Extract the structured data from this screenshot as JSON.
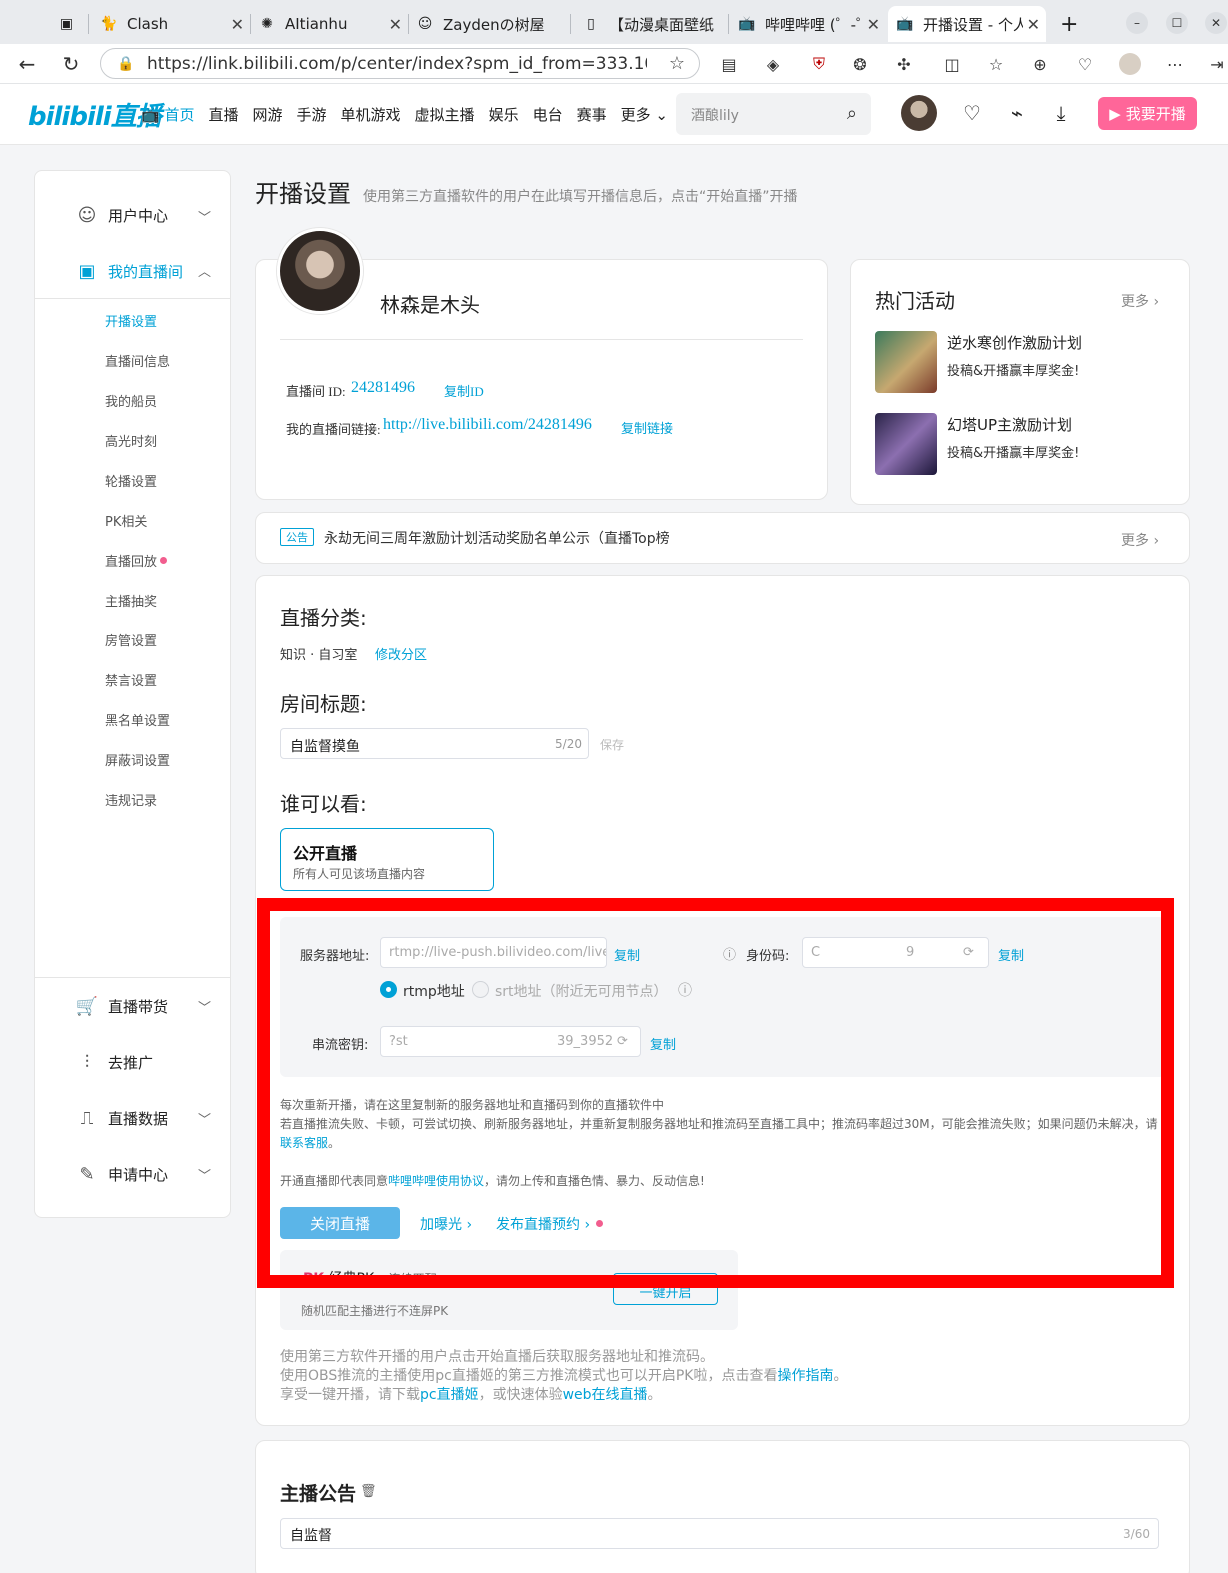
{
  "browser": {
    "tabs": [
      {
        "title": "Clash",
        "icon": "cat-icon"
      },
      {
        "title": "AItianhu",
        "icon": "openai-icon"
      },
      {
        "title": "Zaydenの树屋",
        "icon": "emoji-icon"
      },
      {
        "title": "【动漫桌面壁纸",
        "icon": "page-icon"
      },
      {
        "title": "哔哩哔哩 (゜-゜",
        "icon": "bilibili-icon"
      },
      {
        "title": "开播设置 - 个人",
        "icon": "bilibili-icon"
      }
    ],
    "url": "https://link.bilibili.com/p/center/index?spm_id_from=333.100..."
  },
  "header": {
    "logo": "bilibili直播",
    "nav": [
      "首页",
      "直播",
      "网游",
      "手游",
      "单机游戏",
      "虚拟主播",
      "娱乐",
      "电台",
      "赛事",
      "更多"
    ],
    "search_placeholder": "酒酿lily",
    "go_live_label": "我要开播"
  },
  "sidebar": {
    "groups": [
      {
        "label": "用户中心",
        "icon": "user-center-icon"
      },
      {
        "label": "我的直播间",
        "icon": "live-room-icon"
      }
    ],
    "items": [
      "开播设置",
      "直播间信息",
      "我的船员",
      "高光时刻",
      "轮播设置",
      "PK相关",
      "直播回放",
      "主播抽奖",
      "房管设置",
      "禁言设置",
      "黑名单设置",
      "屏蔽词设置",
      "违规记录"
    ],
    "bottom_groups": [
      {
        "label": "直播带货",
        "icon": "cart-icon"
      },
      {
        "label": "去推广",
        "icon": "promote-icon"
      },
      {
        "label": "直播数据",
        "icon": "data-icon"
      },
      {
        "label": "申请中心",
        "icon": "apply-icon"
      }
    ]
  },
  "page": {
    "title": "开播设置",
    "subtitle": "使用第三方直播软件的用户在此填写开播信息后，点击“开始直播”开播"
  },
  "profile": {
    "name": "林森是木头",
    "room_id_label": "直播间 ID:",
    "room_id": "24281496",
    "copy_id": "复制ID",
    "link_label": "我的直播间链接:",
    "link": "http://live.bilibili.com/24281496",
    "copy_link": "复制链接"
  },
  "hot": {
    "title": "热门活动",
    "more": "更多",
    "items": [
      {
        "title": "逆水寒创作激励计划",
        "desc": "投稿&开播赢丰厚奖金!"
      },
      {
        "title": "幻塔UP主激励计划",
        "desc": "投稿&开播赢丰厚奖金!"
      }
    ]
  },
  "notice": {
    "tag": "公告",
    "text": "永劫无间三周年激励计划活动奖励名单公示（直播Top榜",
    "more": "更多"
  },
  "settings": {
    "category_h": "直播分类:",
    "category": "知识 · 自习室",
    "change_category": "修改分区",
    "room_title_h": "房间标题:",
    "room_title": "自监督摸鱼",
    "room_title_count": "5/20",
    "save": "保存",
    "who_h": "谁可以看:",
    "public_title": "公开直播",
    "public_desc": "所有人可见该场直播内容"
  },
  "server": {
    "addr_label": "服务器地址:",
    "addr_value": "rtmp://live-push.bilivideo.com/live-bv",
    "copy": "复制",
    "id_label": "身份码:",
    "id_prefix": "C",
    "id_suffix": "9",
    "rtmp_label": "rtmp地址",
    "srt_label": "srt地址（附近无可用节点）",
    "key_label": "串流密钥:",
    "key_prefix": "?st",
    "key_suffix": "39_3952"
  },
  "tips": {
    "line1": "每次重新开播，请在这里复制新的服务器地址和直播码到你的直播软件中",
    "line2a": "若直播推流失败、卡顿，可尝试切换、刷新服务器地址，并重新复制服务器地址和推流码至直播工具中；推流码率超过30M，可能会推流失败；如果问题仍未解决，请",
    "line2b": "联",
    "line2c": "系客服",
    "line2d": "。",
    "agree_a": "开通直播即代表同意",
    "agree_link": "哔哩哔哩使用协议",
    "agree_b": "，请勿上传和直播色情、暴力、反动信息!"
  },
  "actions": {
    "close_live": "关闭直播",
    "boost": "加曝光",
    "schedule": "发布直播预约"
  },
  "pk": {
    "title": "经典PK",
    "switch_label": "连续匹配",
    "button": "一键开启",
    "desc": "随机匹配主播进行不连屏PK"
  },
  "bottom_tips": {
    "l1": "使用第三方软件开播的用户点击开始直播后获取服务器地址和推流码。",
    "l2a": "使用OBS推流的主播使用pc直播姬的第三方推流模式也可以开启PK啦，点击查看",
    "l2b": "操作指南",
    "l2c": "。",
    "l3a": "享受一键开播，请下载",
    "l3b": "pc直播姬",
    "l3c": "，或快速体验",
    "l3d": "web在线直播",
    "l3e": "。"
  },
  "announcement": {
    "title": "主播公告",
    "value": "自监督",
    "count": "3/60"
  },
  "colors": {
    "accent": "#00a1d6",
    "pink": "#ff6699",
    "highlight": "#ff0000"
  }
}
